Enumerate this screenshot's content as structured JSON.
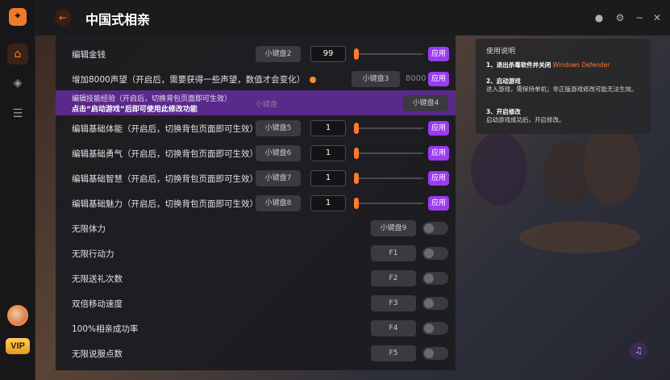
{
  "window": {
    "title": "中国式相亲",
    "back_icon": "arrow-left-icon",
    "controls": [
      "record-icon",
      "settings-icon",
      "minimize-icon",
      "close-icon"
    ]
  },
  "rail": {
    "vip_label": "VIP"
  },
  "rows": [
    {
      "label": "编辑金钱",
      "key": "小键盘2",
      "value": "99",
      "apply": "应用"
    },
    {
      "label": "增加8000声望（开启后，需要获得一些声望，数值才会变化）",
      "key": "小键盘3",
      "value": "8000",
      "apply": "应用"
    },
    {
      "label": "编辑技能经验（开启后，切换背包页面即可生效）",
      "key": "小键盘4"
    },
    {
      "label": "编辑基础体能（开启后，切换背包页面即可生效）",
      "key": "小键盘5",
      "value": "1",
      "apply": "应用"
    },
    {
      "label": "编辑基础勇气（开启后，切换背包页面即可生效）",
      "key": "小键盘6",
      "value": "1",
      "apply": "应用"
    },
    {
      "label": "编辑基础智慧（开启后，切换背包页面即可生效）",
      "key": "小键盘7",
      "value": "1",
      "apply": "应用"
    },
    {
      "label": "编辑基础魅力（开启后，切换背包页面即可生效）",
      "key": "小键盘8",
      "value": "1",
      "apply": "应用"
    },
    {
      "label": "无限体力",
      "key": "小键盘9"
    },
    {
      "label": "无限行动力",
      "key": "F1"
    },
    {
      "label": "无限送礼次数",
      "key": "F2"
    },
    {
      "label": "双倍移动速度",
      "key": "F3"
    },
    {
      "label": "100%相亲成功率",
      "key": "F4"
    },
    {
      "label": "无限说服点数",
      "key": "F5"
    }
  ],
  "tooltip": {
    "line1": "编辑技能经验（开启后，切换背包页面即可生效）",
    "line2": "点击“启动游戏”后即可使用此修改功能",
    "ghost": "小键盘"
  },
  "help": {
    "title": "使用说明",
    "step1_title": "1、退出杀毒软件并关闭",
    "step1_highlight": "Windows Defender",
    "step2_title": "2、启动游戏",
    "step2_body": "进入游戏，需保持单机；非正版游戏修改可能无法生效。",
    "step3_title": "3、开启修改",
    "step3_body": "启动游戏成功后，开启修改。"
  },
  "colors": {
    "accent_orange": "#ff7a2a",
    "accent_purple": "#9b3cf0",
    "panel_bg": "#1c1c20"
  }
}
